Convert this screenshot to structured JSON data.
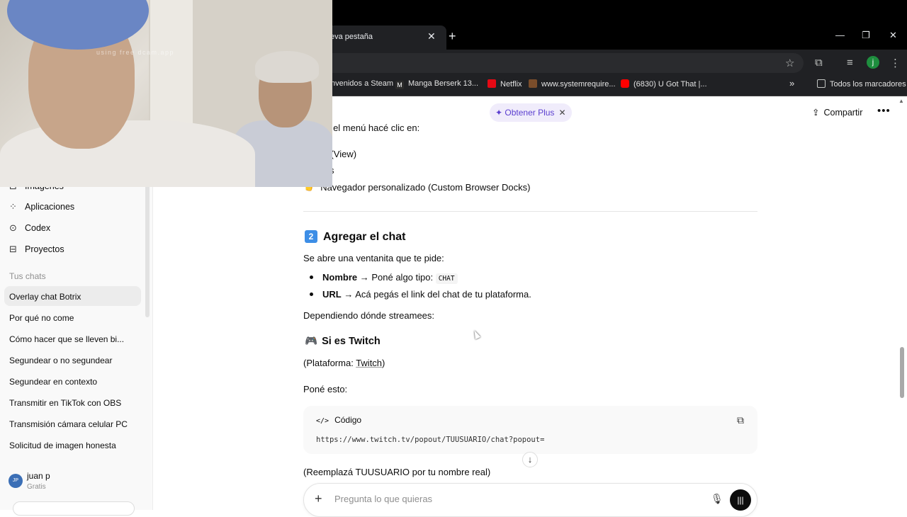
{
  "browser": {
    "tab_title": "eva pestaña",
    "tab_close": "✕",
    "new_tab": "+",
    "window_buttons": [
      "—",
      "❐",
      "✕"
    ],
    "profile_initial": "j",
    "bookmarks": [
      {
        "label": "nvenidos a Steam",
        "color": "#1b2838"
      },
      {
        "label": "Manga Berserk 13...",
        "color": "#2b2b2b"
      },
      {
        "label": "Netflix",
        "color": "#e50914"
      },
      {
        "label": "www.systemrequire...",
        "color": "#7a4d2b"
      },
      {
        "label": "(6830) U Got That |...",
        "color": "#ff0000"
      }
    ],
    "bookmarks_overflow": "»",
    "all_bookmarks": "Todos los marcadores"
  },
  "webcam": {
    "watermark": "using free dcam.app"
  },
  "sidebar": {
    "items": [
      {
        "label": "Imágenes",
        "icon": "image-icon",
        "glyph": "⊡"
      },
      {
        "label": "Aplicaciones",
        "icon": "apps-icon",
        "glyph": "⁘"
      },
      {
        "label": "Codex",
        "icon": "codex-icon",
        "glyph": "⊙"
      },
      {
        "label": "Proyectos",
        "icon": "folder-icon",
        "glyph": "⊟"
      }
    ],
    "section_title": "Tus chats",
    "chats": [
      "Overlay chat Botrix",
      "Por qué no come",
      "Cómo hacer que se lleven bi...",
      "Segundear o no segundear",
      "Segundear en contexto",
      "Transmitir en TikTok con OBS",
      "Transmisión cámara celular PC",
      "Solicitud de imagen honesta"
    ],
    "user": {
      "initials": "JP",
      "name": "juan p",
      "plan": "Gratis"
    }
  },
  "header": {
    "plus_label": "✦ Obtener Plus",
    "plus_close": "✕",
    "share_label": "Compartir",
    "more_label": "•••"
  },
  "message": {
    "intro_partial": "en el menú hacé clic en:",
    "menu_steps": [
      "ta (View)",
      "cks",
      "Navegador personalizado (Custom Browser Docks)"
    ],
    "section2_number": "2",
    "section2_title": "Agregar el chat",
    "section2_intro": "Se abre una ventanita que te pide:",
    "fields": [
      {
        "name": "Nombre",
        "text": " → Poné algo tipo: ",
        "code": "CHAT"
      },
      {
        "name": "URL",
        "text": " → Acá pegás el link del chat de tu plataforma.",
        "code": ""
      }
    ],
    "depending": "Dependiendo dónde streamees:",
    "twitch_title": "Si es Twitch",
    "platform_prefix": "(Plataforma: ",
    "platform_name": "Twitch",
    "platform_suffix": ")",
    "put_this": "Poné esto:",
    "code_label": "Código",
    "code_url": "https://www.twitch.tv/popout/TUUSUARIO/chat?popout=",
    "replace_note": "(Reemplazá TUUSUARIO por tu nombre real)"
  },
  "composer": {
    "placeholder": "Pregunta lo que quieras"
  }
}
